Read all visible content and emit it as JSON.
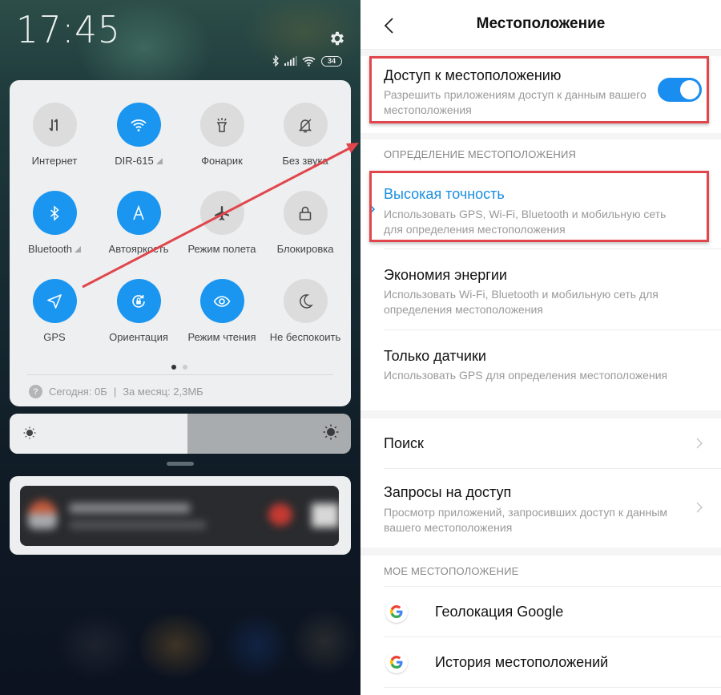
{
  "shade": {
    "clock": "17:45",
    "battery": "34",
    "status_icons": [
      "bluetooth-icon",
      "signal-icon",
      "wifi-icon",
      "battery-icon"
    ],
    "tiles": [
      {
        "label": "Интернет",
        "icon": "mobile-data-icon",
        "active": false,
        "has_menu": false
      },
      {
        "label": "DIR-615",
        "icon": "wifi-icon",
        "active": true,
        "has_menu": true
      },
      {
        "label": "Фонарик",
        "icon": "flashlight-icon",
        "active": false,
        "has_menu": false
      },
      {
        "label": "Без звука",
        "icon": "mute-icon",
        "active": false,
        "has_menu": false
      },
      {
        "label": "Bluetooth",
        "icon": "bluetooth-icon",
        "active": true,
        "has_menu": true
      },
      {
        "label": "Автояркость",
        "icon": "auto-brightness-icon",
        "active": true,
        "has_menu": false
      },
      {
        "label": "Режим полета",
        "icon": "airplane-icon",
        "active": false,
        "has_menu": false
      },
      {
        "label": "Блокировка",
        "icon": "lock-icon",
        "active": false,
        "has_menu": false
      },
      {
        "label": "GPS",
        "icon": "gps-icon",
        "active": true,
        "has_menu": false
      },
      {
        "label": "Ориентация",
        "icon": "rotation-lock-icon",
        "active": true,
        "has_menu": false
      },
      {
        "label": "Режим чтения",
        "icon": "eye-icon",
        "active": true,
        "has_menu": false
      },
      {
        "label": "Не беспокоить",
        "icon": "moon-icon",
        "active": false,
        "has_menu": false
      }
    ],
    "page_indicator": {
      "current": 1,
      "total": 2
    },
    "data_usage": {
      "help_glyph": "?",
      "today": "Сегодня: 0Б",
      "divider": "|",
      "month": "За месяц: 2,3МБ"
    },
    "brightness": 0.52
  },
  "settings": {
    "title": "Местоположение",
    "location_access": {
      "title": "Доступ к местоположению",
      "subtitle": "Разрешить приложениям доступ к данным вашего местоположения",
      "enabled": true
    },
    "mode_section": "ОПРЕДЕЛЕНИЕ МЕСТОПОЛОЖЕНИЯ",
    "modes": [
      {
        "title": "Высокая точность",
        "subtitle": "Использовать GPS, Wi-Fi, Bluetooth и мобильную сеть для определения местоположения",
        "selected": true
      },
      {
        "title": "Экономия энергии",
        "subtitle": "Использовать Wi-Fi, Bluetooth и мобильную сеть для определения местоположения",
        "selected": false
      },
      {
        "title": "Только датчики",
        "subtitle": "Использовать GPS для определения местоположения",
        "selected": false
      }
    ],
    "links": [
      {
        "title": "Поиск",
        "subtitle": ""
      },
      {
        "title": "Запросы на доступ",
        "subtitle": "Просмотр приложений, запросивших доступ к данным вашего местоположения"
      }
    ],
    "my_location_section": "МОЕ МЕСТОПОЛОЖЕНИЕ",
    "google_items": [
      {
        "title": "Геолокация Google",
        "icon": "google-icon"
      },
      {
        "title": "История местоположений",
        "icon": "google-icon"
      }
    ]
  },
  "colors": {
    "accent": "#1a8ef0",
    "tile_active": "#1a96f0",
    "tile_inactive": "#dcdcdc",
    "annotation_red": "#e0464c"
  }
}
